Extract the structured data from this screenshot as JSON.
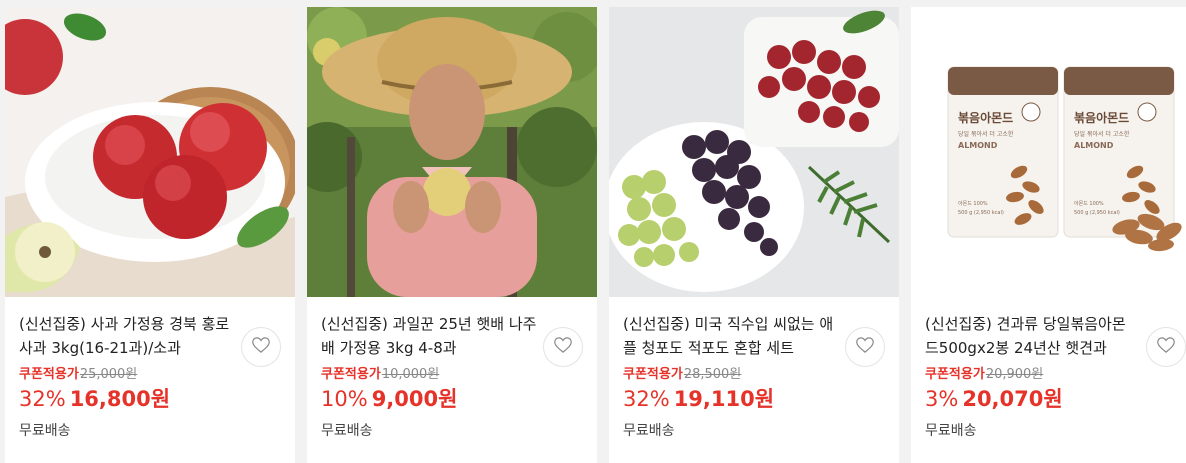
{
  "products": [
    {
      "title": "(신선집중) 사과 가정용 경북 홍로사과 3kg(16-21과)/소과",
      "coupon_label": "쿠폰적용가",
      "original_price": "25,000원",
      "discount": "32%",
      "price": "16,800원",
      "shipping": "무료배송",
      "image": "apples-photo"
    },
    {
      "title": "(신선집중) 과일꾼 25년 햇배 나주배 가정용 3kg 4-8과",
      "coupon_label": "쿠폰적용가",
      "original_price": "10,000원",
      "discount": "10%",
      "price": "9,000원",
      "shipping": "무료배송",
      "image": "farmer-pear-photo"
    },
    {
      "title": "(신선집중) 미국 직수입 씨없는 애플 청포도 적포도 혼합 세트",
      "coupon_label": "쿠폰적용가",
      "original_price": "28,500원",
      "discount": "32%",
      "price": "19,110원",
      "shipping": "무료배송",
      "image": "grapes-photo"
    },
    {
      "title": "(신선집중) 견과류 당일볶음아몬드500gx2봉 24년산 햇견과",
      "coupon_label": "쿠폰적용가",
      "original_price": "20,900원",
      "discount": "3%",
      "price": "20,070원",
      "shipping": "무료배송",
      "image": "almond-bags-photo",
      "package_text": {
        "name": "볶음아몬드",
        "sub": "당일 볶아서 더 고소한",
        "brand": "ALMOND",
        "origin": "아몬드 100%",
        "weight": "500 g  (2,950 kcal)"
      }
    }
  ],
  "colors": {
    "accent": "#e5332a",
    "background": "#f2f2f2"
  },
  "icons": {
    "wishlist": "heart-outline-icon"
  }
}
